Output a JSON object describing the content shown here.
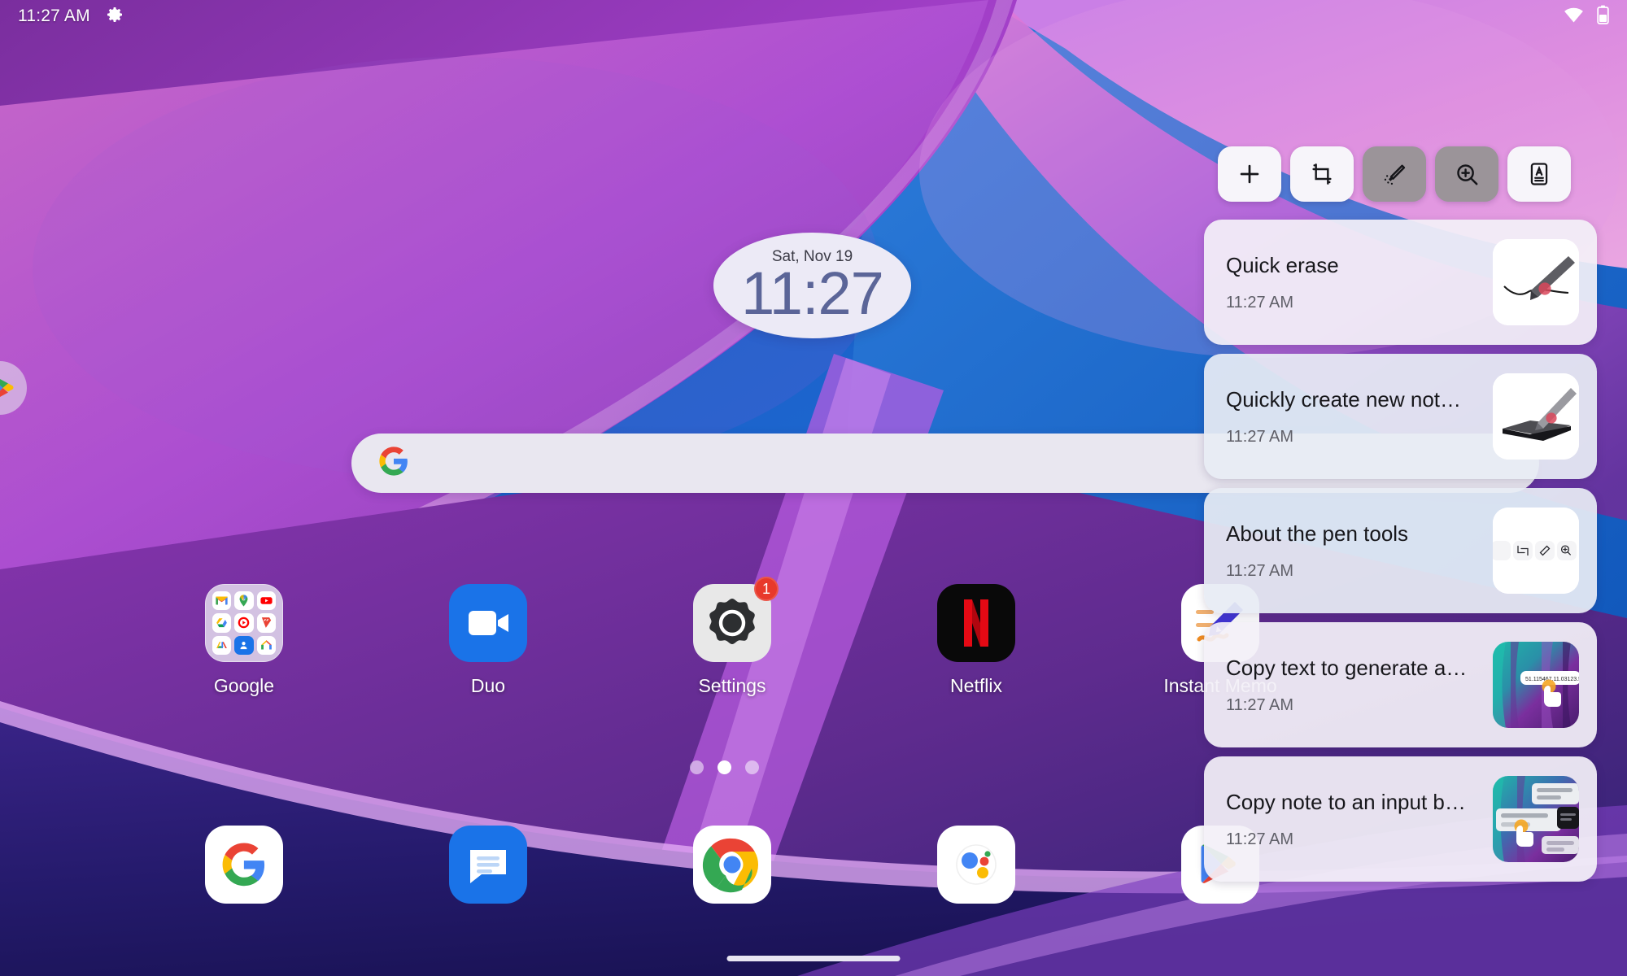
{
  "status_bar": {
    "time": "11:27 AM",
    "settings_icon": "gear-icon",
    "wifi_icon": "wifi-icon",
    "battery_icon": "battery-icon"
  },
  "clock_widget": {
    "date": "Sat, Nov 19",
    "time": "11:27"
  },
  "search": {
    "value": "",
    "placeholder": "",
    "logo": "google-g-icon"
  },
  "apps": [
    {
      "label": "Google",
      "icon": "google-folder-icon",
      "badge": ""
    },
    {
      "label": "Duo",
      "icon": "duo-icon",
      "badge": ""
    },
    {
      "label": "Settings",
      "icon": "settings-icon",
      "badge": "1"
    },
    {
      "label": "Netflix",
      "icon": "netflix-icon",
      "badge": ""
    },
    {
      "label": "Instant Memo",
      "icon": "instant-memo-icon",
      "badge": ""
    }
  ],
  "folder_apps": [
    "gmail-icon",
    "maps-icon",
    "youtube-icon",
    "drive-icon",
    "youtube-music-icon",
    "play-movies-icon",
    "google-one-icon",
    "contacts-icon",
    "google-home-icon"
  ],
  "dock": [
    {
      "label": "Google Search",
      "icon": "google-g-icon"
    },
    {
      "label": "Messages",
      "icon": "messages-icon"
    },
    {
      "label": "Chrome",
      "icon": "chrome-icon"
    },
    {
      "label": "Google Assistant",
      "icon": "assistant-icon"
    },
    {
      "label": "Play Store",
      "icon": "play-store-icon"
    }
  ],
  "page_indicator": {
    "total": 3,
    "active": 2
  },
  "left_peek": {
    "icon": "play-store-icon"
  },
  "pen_panel": {
    "toolbar": [
      {
        "name": "add-note-button",
        "icon": "plus-icon",
        "state": "normal"
      },
      {
        "name": "crop-button",
        "icon": "crop-icon",
        "state": "normal"
      },
      {
        "name": "quick-erase-button",
        "icon": "magic-pen-icon",
        "state": "dimmed"
      },
      {
        "name": "magnify-button",
        "icon": "zoom-in-icon",
        "state": "dimmed"
      },
      {
        "name": "text-note-button",
        "icon": "text-card-icon",
        "state": "normal"
      }
    ],
    "notifications": [
      {
        "title": "Quick erase",
        "time": "11:27 AM",
        "thumb": "pen-stroke-thumb",
        "tint": "pink"
      },
      {
        "title": "Quickly create new not…",
        "time": "11:27 AM",
        "thumb": "pen-tablet-thumb",
        "tint": "blue"
      },
      {
        "title": "About the pen tools",
        "time": "11:27 AM",
        "thumb": "mini-toolbar-thumb",
        "tint": "blue"
      },
      {
        "title": "Copy text to generate a…",
        "time": "11:27 AM",
        "thumb": "copy-text-thumb",
        "tint": "pink"
      },
      {
        "title": "Copy note to an input b…",
        "time": "11:27 AM",
        "thumb": "copy-note-thumb",
        "tint": "pink"
      }
    ]
  },
  "home_bar": {
    "name": "home-gesture-bar"
  },
  "colors": {
    "accent_purple": "#8e3fbe",
    "clock_text": "#5b6598",
    "badge_red": "#e8392b",
    "card_bg": "#f3f0f7"
  }
}
